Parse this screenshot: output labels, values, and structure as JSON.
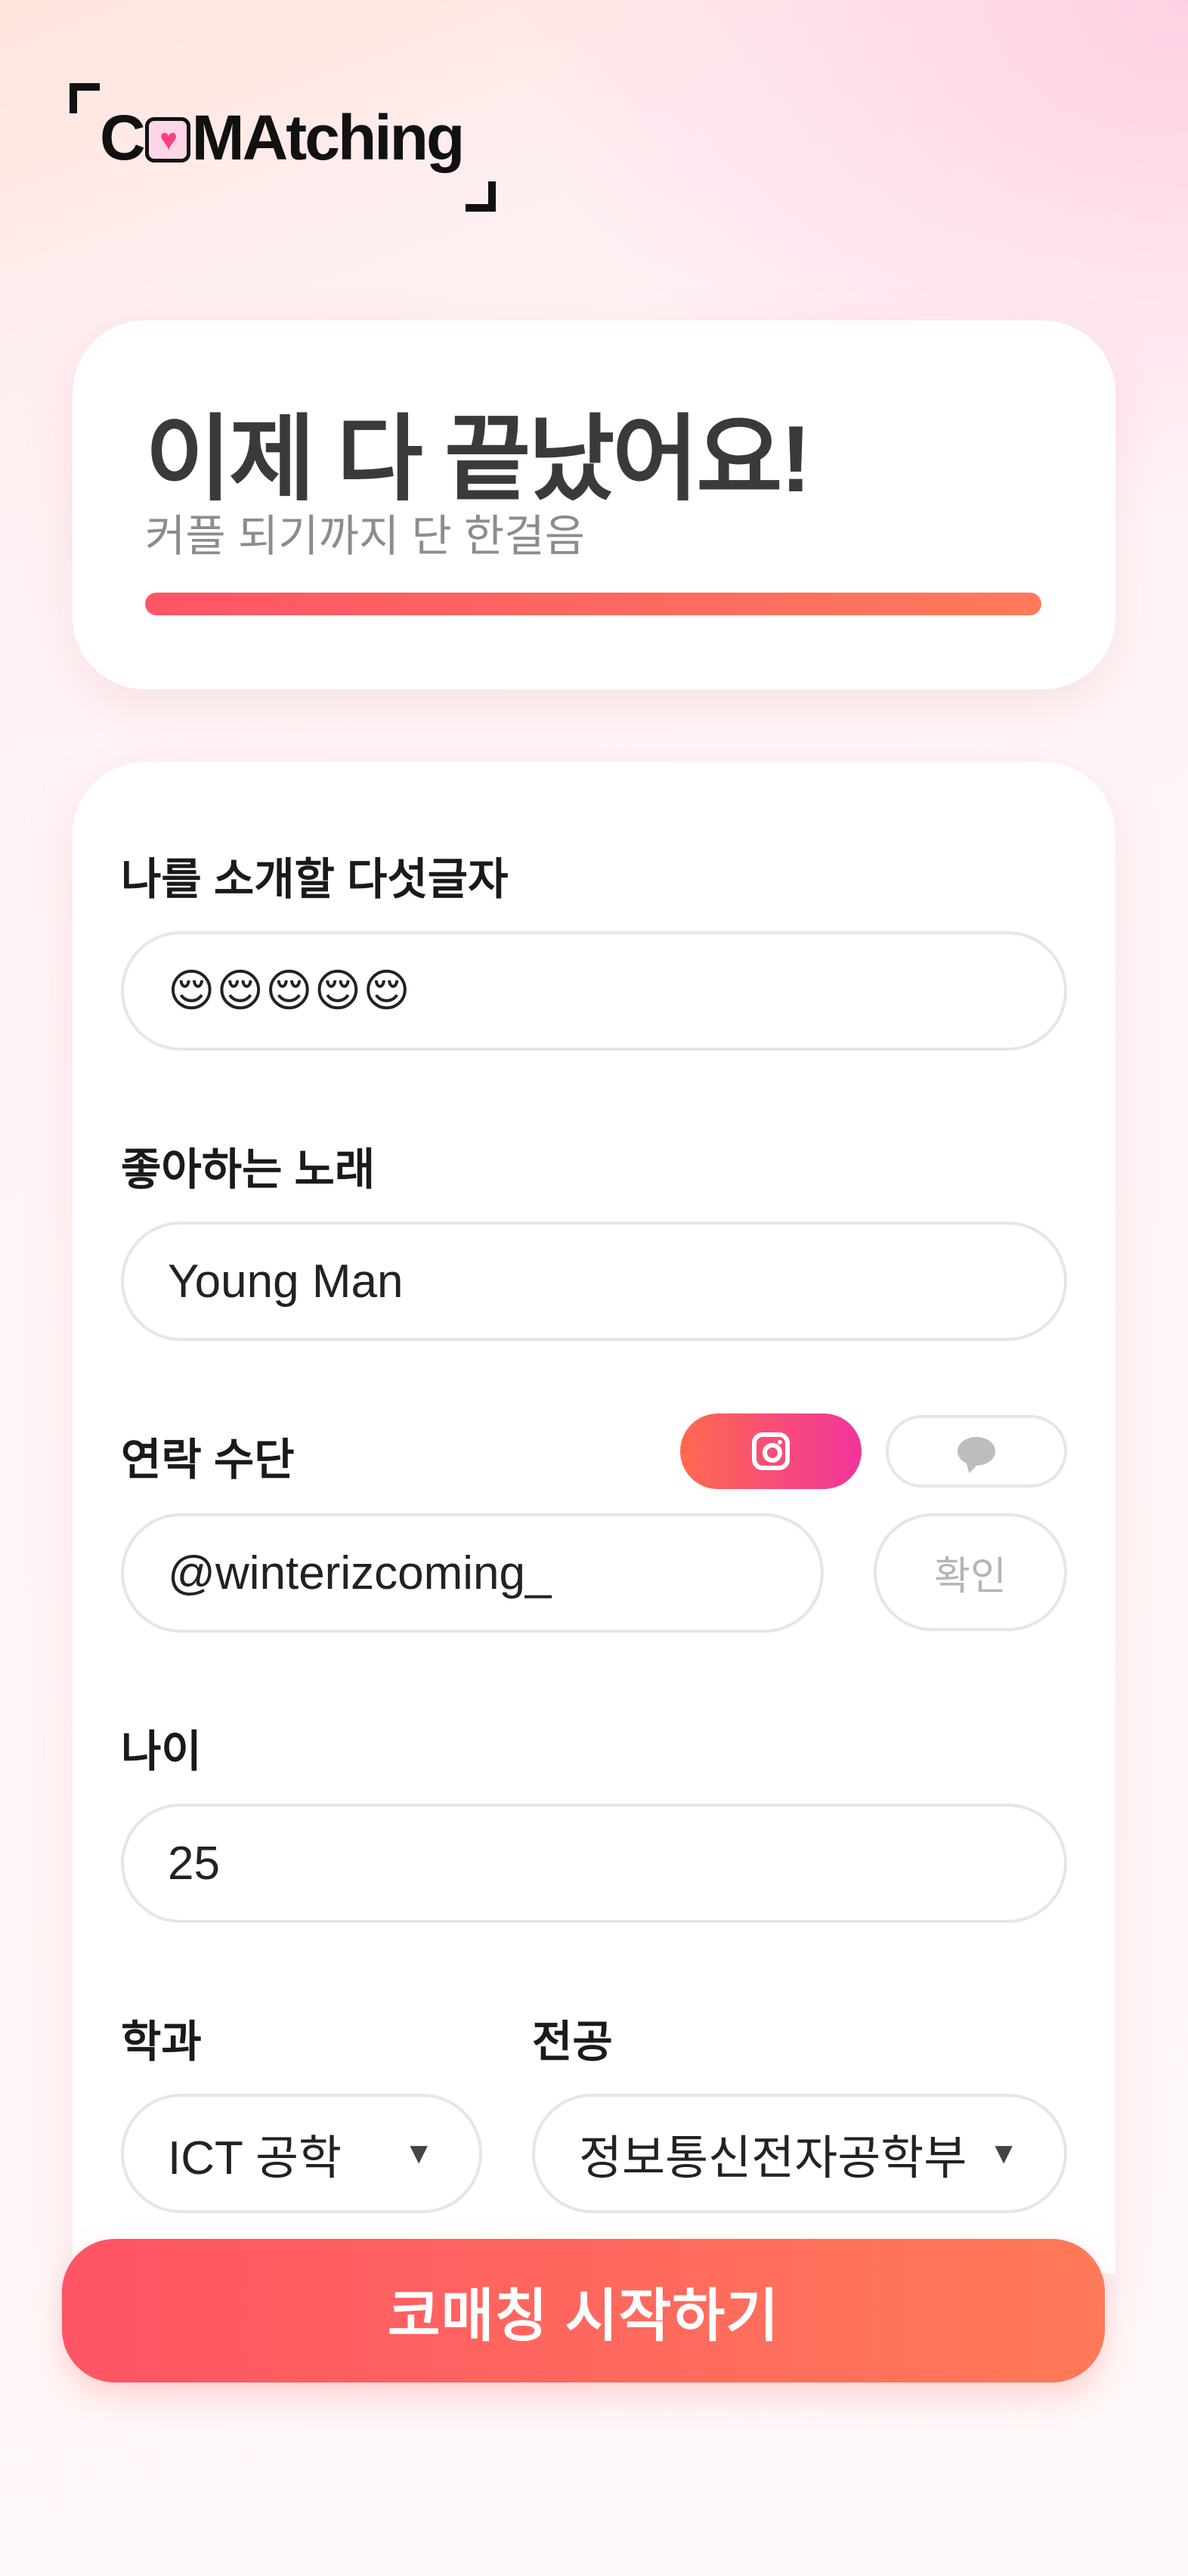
{
  "app": {
    "logo_text_before": "C",
    "logo_text_after": "MAtching"
  },
  "header": {
    "title": "이제 다 끝났어요!",
    "subtitle": "커플 되기까지 단 한걸음",
    "progress": 1.0
  },
  "form": {
    "intro": {
      "label": "나를 소개할 다섯글자",
      "value": "😌😌😌😌😌"
    },
    "song": {
      "label": "좋아하는 노래",
      "value": "Young Man"
    },
    "contact": {
      "label": "연락 수단",
      "value": "@winterizcoming_",
      "options": [
        {
          "icon": "instagram-icon",
          "selected": true
        },
        {
          "icon": "chat-bubble-icon",
          "selected": false
        }
      ],
      "confirm_label": "확인"
    },
    "age": {
      "label": "나이",
      "value": "25"
    },
    "department": {
      "label": "학과",
      "value": "ICT 공학"
    },
    "major": {
      "label": "전공",
      "value": "정보통신전자공학부"
    }
  },
  "cta": {
    "label": "코매칭 시작하기"
  },
  "colors": {
    "accent_start": "#ff5566",
    "accent_end": "#ff7a5a",
    "insta_start": "#ff6a4f",
    "insta_end": "#f0349c"
  }
}
